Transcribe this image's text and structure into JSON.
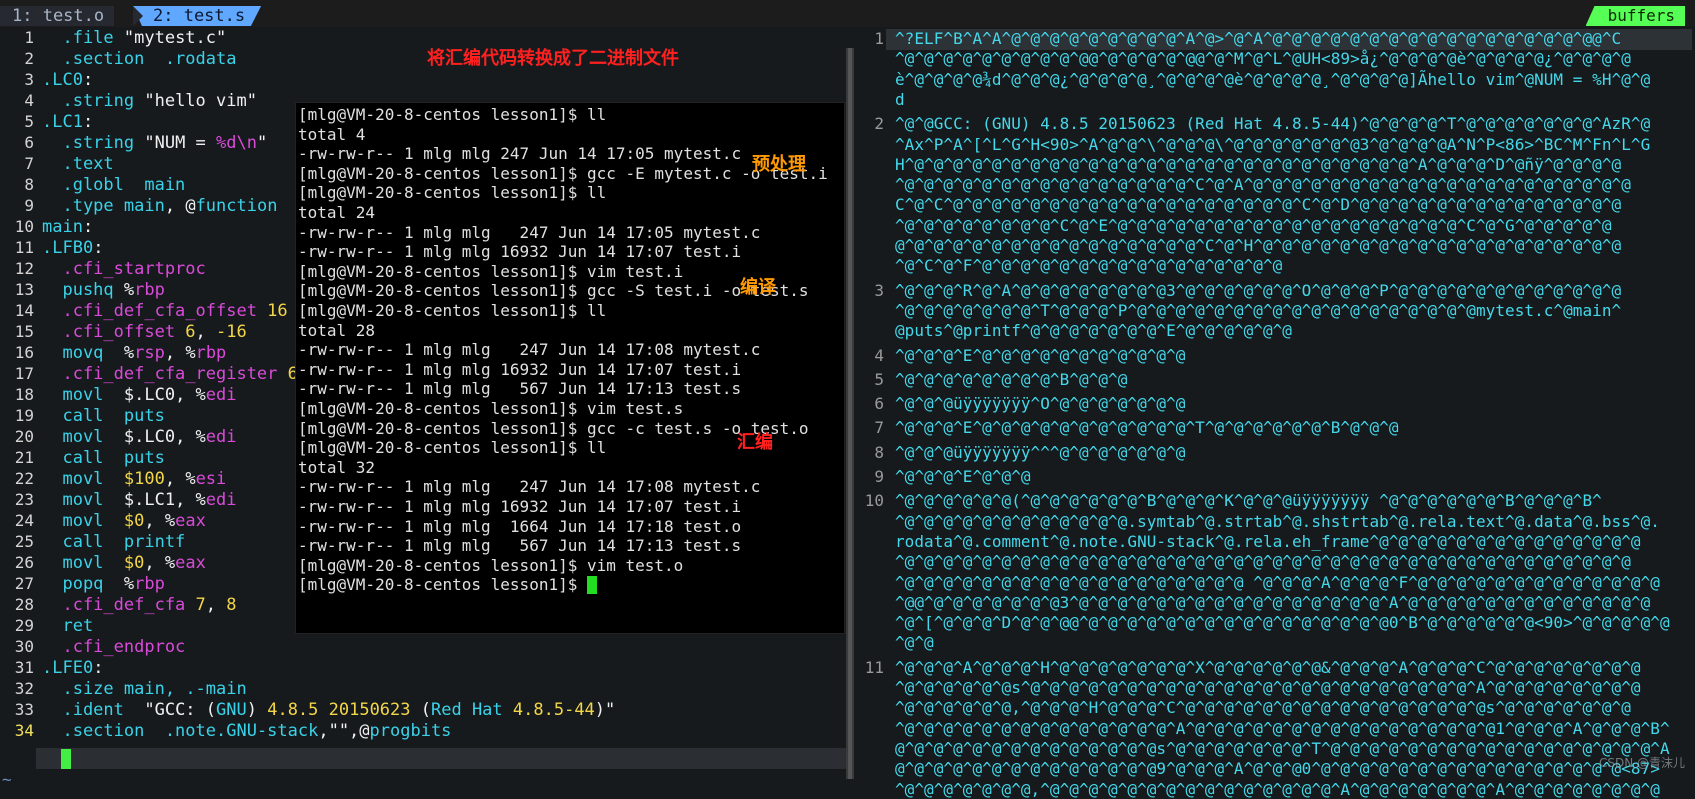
{
  "tabs": {
    "tab1": "1: test.o",
    "tab2": "2: test.s",
    "right": "buffers"
  },
  "left": {
    "numbers": [
      "1",
      "2",
      "3",
      "4",
      "5",
      "6",
      "7",
      "8",
      "9",
      "10",
      "11",
      "12",
      "13",
      "14",
      "15",
      "16",
      "17",
      "18",
      "19",
      "20",
      "21",
      "22",
      "23",
      "24",
      "25",
      "26",
      "27",
      "28",
      "29",
      "30",
      "31",
      "32",
      "33",
      "34"
    ],
    "lines": [
      [
        {
          "t": "  .file ",
          "c": "c-dir"
        },
        {
          "t": "\"mytest.c\"",
          "c": "c-str"
        }
      ],
      [
        {
          "t": "  .section  .rodata",
          "c": "c-dir"
        }
      ],
      [
        {
          "t": ".LC0",
          "c": "c-dir"
        },
        {
          "t": ":",
          "c": "c-lbl"
        }
      ],
      [
        {
          "t": "  .string ",
          "c": "c-dir"
        },
        {
          "t": "\"hello vim\"",
          "c": "c-str"
        }
      ],
      [
        {
          "t": ".LC1",
          "c": "c-dir"
        },
        {
          "t": ":",
          "c": "c-lbl"
        }
      ],
      [
        {
          "t": "  .string ",
          "c": "c-dir"
        },
        {
          "t": "\"NUM = ",
          "c": "c-str"
        },
        {
          "t": "%d",
          "c": "c-fmt"
        },
        {
          "t": "\\n",
          "c": "c-fmt"
        },
        {
          "t": "\"",
          "c": "c-str"
        }
      ],
      [
        {
          "t": "  .text",
          "c": "c-dir"
        }
      ],
      [
        {
          "t": "  .globl  main",
          "c": "c-dir"
        }
      ],
      [
        {
          "t": "  .type ",
          "c": "c-dir"
        },
        {
          "t": "main",
          "c": "c-func"
        },
        {
          "t": ", @",
          "c": "c-pct"
        },
        {
          "t": "function",
          "c": "c-func"
        }
      ],
      [
        {
          "t": "main",
          "c": "c-dir"
        },
        {
          "t": ":",
          "c": "c-lbl"
        }
      ],
      [
        {
          "t": ".LFB0",
          "c": "c-dir"
        },
        {
          "t": ":",
          "c": "c-lbl"
        }
      ],
      [
        {
          "t": "  .cfi_startproc",
          "c": "c-reg"
        }
      ],
      [
        {
          "t": "  pushq ",
          "c": "c-kw"
        },
        {
          "t": "%",
          "c": "c-pct"
        },
        {
          "t": "rbp",
          "c": "c-reg"
        }
      ],
      [
        {
          "t": "  .cfi_def_cfa_offset ",
          "c": "c-reg"
        },
        {
          "t": "16",
          "c": "c-num"
        }
      ],
      [
        {
          "t": "  .cfi_offset ",
          "c": "c-reg"
        },
        {
          "t": "6",
          "c": "c-num"
        },
        {
          "t": ", ",
          "c": "c-pct"
        },
        {
          "t": "-16",
          "c": "c-num"
        }
      ],
      [
        {
          "t": "  movq  ",
          "c": "c-kw"
        },
        {
          "t": "%",
          "c": "c-pct"
        },
        {
          "t": "rsp",
          "c": "c-reg"
        },
        {
          "t": ", %",
          "c": "c-pct"
        },
        {
          "t": "rbp",
          "c": "c-reg"
        }
      ],
      [
        {
          "t": "  .cfi_def_cfa_register ",
          "c": "c-reg"
        },
        {
          "t": "6",
          "c": "c-num"
        }
      ],
      [
        {
          "t": "  movl  ",
          "c": "c-kw"
        },
        {
          "t": "$.LC0, %",
          "c": "c-pct"
        },
        {
          "t": "edi",
          "c": "c-reg"
        }
      ],
      [
        {
          "t": "  call  puts",
          "c": "c-kw"
        }
      ],
      [
        {
          "t": "  movl  ",
          "c": "c-kw"
        },
        {
          "t": "$.LC0, %",
          "c": "c-pct"
        },
        {
          "t": "edi",
          "c": "c-reg"
        }
      ],
      [
        {
          "t": "  call  puts",
          "c": "c-kw"
        }
      ],
      [
        {
          "t": "  movl  ",
          "c": "c-kw"
        },
        {
          "t": "$100",
          "c": "c-num"
        },
        {
          "t": ", %",
          "c": "c-pct"
        },
        {
          "t": "esi",
          "c": "c-reg"
        }
      ],
      [
        {
          "t": "  movl  ",
          "c": "c-kw"
        },
        {
          "t": "$.LC1, %",
          "c": "c-pct"
        },
        {
          "t": "edi",
          "c": "c-reg"
        }
      ],
      [
        {
          "t": "  movl  ",
          "c": "c-kw"
        },
        {
          "t": "$0",
          "c": "c-num"
        },
        {
          "t": ", %",
          "c": "c-pct"
        },
        {
          "t": "eax",
          "c": "c-reg"
        }
      ],
      [
        {
          "t": "  call  printf",
          "c": "c-kw"
        }
      ],
      [
        {
          "t": "  movl  ",
          "c": "c-kw"
        },
        {
          "t": "$0",
          "c": "c-num"
        },
        {
          "t": ", %",
          "c": "c-pct"
        },
        {
          "t": "eax",
          "c": "c-reg"
        }
      ],
      [
        {
          "t": "  popq  ",
          "c": "c-kw"
        },
        {
          "t": "%",
          "c": "c-pct"
        },
        {
          "t": "rbp",
          "c": "c-reg"
        }
      ],
      [
        {
          "t": "  .cfi_def_cfa ",
          "c": "c-reg"
        },
        {
          "t": "7",
          "c": "c-num"
        },
        {
          "t": ", ",
          "c": "c-pct"
        },
        {
          "t": "8",
          "c": "c-num"
        }
      ],
      [
        {
          "t": "  ret",
          "c": "c-kw"
        }
      ],
      [
        {
          "t": "  .cfi_endproc",
          "c": "c-reg"
        }
      ],
      [
        {
          "t": ".LFE0",
          "c": "c-dir"
        },
        {
          "t": ":",
          "c": "c-lbl"
        }
      ],
      [
        {
          "t": "  .size ",
          "c": "c-dir"
        },
        {
          "t": "main",
          "c": "c-func"
        },
        {
          "t": ", .-main",
          "c": "c-dir"
        }
      ],
      [
        {
          "t": "  .ident  ",
          "c": "c-dir"
        },
        {
          "t": "\"GCC: (",
          "c": "c-str"
        },
        {
          "t": "GNU",
          "c": "c-dir"
        },
        {
          "t": ") ",
          "c": "c-str"
        },
        {
          "t": "4.8.5 20150623",
          "c": "c-num"
        },
        {
          "t": " (",
          "c": "c-str"
        },
        {
          "t": "Red Hat",
          "c": "c-dir"
        },
        {
          "t": " ",
          "c": "c-str"
        },
        {
          "t": "4.8.5-44",
          "c": "c-num"
        },
        {
          "t": ")\"",
          "c": "c-str"
        }
      ],
      [
        {
          "t": "  .section  .note.GNU-stack",
          "c": "c-dir"
        },
        {
          "t": ",\"\",@",
          "c": "c-str"
        },
        {
          "t": "progbits",
          "c": "c-dir"
        }
      ]
    ],
    "tilde": "~"
  },
  "terminal": {
    "lines": [
      "[mlg@VM-20-8-centos lesson1]$ ll",
      "total 4",
      "-rw-rw-r-- 1 mlg mlg 247 Jun 14 17:05 mytest.c",
      "[mlg@VM-20-8-centos lesson1]$ gcc -E mytest.c -o test.i",
      "[mlg@VM-20-8-centos lesson1]$ ll",
      "total 24",
      "-rw-rw-r-- 1 mlg mlg   247 Jun 14 17:05 mytest.c",
      "-rw-rw-r-- 1 mlg mlg 16932 Jun 14 17:07 test.i",
      "[mlg@VM-20-8-centos lesson1]$ vim test.i",
      "[mlg@VM-20-8-centos lesson1]$ gcc -S test.i -o test.s",
      "[mlg@VM-20-8-centos lesson1]$ ll",
      "total 28",
      "-rw-rw-r-- 1 mlg mlg   247 Jun 14 17:08 mytest.c",
      "-rw-rw-r-- 1 mlg mlg 16932 Jun 14 17:07 test.i",
      "-rw-rw-r-- 1 mlg mlg   567 Jun 14 17:13 test.s",
      "[mlg@VM-20-8-centos lesson1]$ vim test.s",
      "[mlg@VM-20-8-centos lesson1]$ gcc -c test.s -o test.o",
      "[mlg@VM-20-8-centos lesson1]$ ll",
      "total 32",
      "-rw-rw-r-- 1 mlg mlg   247 Jun 14 17:08 mytest.c",
      "-rw-rw-r-- 1 mlg mlg 16932 Jun 14 17:07 test.i",
      "-rw-rw-r-- 1 mlg mlg  1664 Jun 14 17:18 test.o",
      "-rw-rw-r-- 1 mlg mlg   567 Jun 14 17:13 test.s",
      "[mlg@VM-20-8-centos lesson1]$ vim test.o",
      "[mlg@VM-20-8-centos lesson1]$ "
    ]
  },
  "annotations": {
    "title": "将汇编代码转换成了二进制文件",
    "preprocess": "预处理",
    "compile": "编译",
    "assemble": "汇编"
  },
  "right": {
    "rows": [
      {
        "n": "1",
        "t": "^?ELF^B^A^A^@^@^@^@^@^@^@^@^@^A^@>^@^A^@^@^@^@^@^@^@^@^@^@^@^@^@^@^@^@^@@^C"
      },
      {
        "n": "",
        "t": "^@^@^@^@^@^@^@^@^@^@@^@^@^@^@^@@^@^M^@^L^@UH<89>å¿^@^@^@^@è^@^@^@^@¿^@^@^@^@"
      },
      {
        "n": "",
        "t": "è^@^@^@^@¾d^@^@^@¿^@^@^@^@¸^@^@^@^@è^@^@^@^@¸^@^@^@^@]Ãhello vim^@NUM = %H^@^@"
      },
      {
        "n": "",
        "t": "d"
      },
      {
        "n": "2",
        "t": "^@^@GCC: (GNU) 4.8.5 20150623 (Red Hat 4.8.5-44)^@^@^@^@^T^@^@^@^@^@^@^@^AzR^@"
      },
      {
        "n": "",
        "t": "^Ax^P^A^[^L^G^H<90>^A^@^@^\\^@^@^@\\^@^@^@^@^@^@^@3^@^@^@^@A^N^P<86>^BC^M^Fn^L^G"
      },
      {
        "n": "",
        "t": "H^@^@^@^@^@^@^@^@^@^@^@^@^@^@^@^@^@^@^@^@^@^@^@^@^@^@^A^@^@^@^D^@ñÿ^@^@^@^@"
      },
      {
        "n": "",
        "t": "^@^@^@^@^@^@^@^@^@^@^@^@^@^@^@^C^@^A^@^@^@^@^@^@^@^@^@^@^@^@^@^@^@^@^@^@^@^@"
      },
      {
        "n": "",
        "t": "C^@^C^@^@^@^@^@^@^@^@^@^@^@^@^@^@^@^@^@^@^C^@^D^@^@^@^@^@^@^@^@^@^@^@^@^@^@"
      },
      {
        "n": "",
        "t": "^@^@^@^@^@^@^@^@^C^@^E^@^@^@^@^@^@^@^@^@^@^@^@^@^@^@^@^@^@^C^@^G^@^@^@^@^@"
      },
      {
        "n": "",
        "t": "@^@^@^@^@^@^@^@^@^@^@^@^@^@^@^@^C^@^H^@^@^@^@^@^@^@^@^@^@^@^@^@^@^@^@^@^@^@"
      },
      {
        "n": "",
        "t": "^@^C^@^F^@^@^@^@^@^@^@^@^@^@^@^@^@^@^@^@"
      },
      {
        "n": "3",
        "t": "^@^@^@^R^@^A^@^@^@^@^@^@^@^@3^@^@^@^@^@^@^O^@^@^@^P^@^@^@^@^@^@^@^@^@^@^@^@"
      },
      {
        "n": "",
        "t": "^@^@^@^@^@^@^@^T^@^@^@^P^@^@^@^@^@^@^@^@^@^@^@^@^@^@^@^@^@^@mytest.c^@main^"
      },
      {
        "n": "",
        "t": "@puts^@printf^@^@^@^@^@^@^@^E^@^@^@^@^@^@"
      },
      {
        "n": "4",
        "t": "^@^@^@^E^@^@^@^@^@^@^@^@^@^@^@"
      },
      {
        "n": "5",
        "t": "^@^@^@^@^@^@^@^@^B^@^@^@"
      },
      {
        "n": "6",
        "t": "^@^@^@üÿÿÿÿÿÿÿ^O^@^@^@^@^@^@^@"
      },
      {
        "n": "7",
        "t": "^@^@^@^E^@^@^@^@^@^@^@^@^@^@^@^T^@^@^@^@^@^@^B^@^@^@"
      },
      {
        "n": "8",
        "t": "^@^@^@üÿÿÿÿÿÿÿ^^^@^@^@^@^@^@^@"
      },
      {
        "n": "9",
        "t": "^@^@^@^E^@^@^@"
      },
      {
        "n": "10",
        "t": "^@^@^@^@^@^@(^@^@^@^@^@^@^B^@^@^@^K^@^@^@üÿÿÿÿÿÿÿ ^@^@^@^@^@^@^B^@^@^@^B^"
      },
      {
        "n": "",
        "t": "^@^@^@^@^@^@^@^@^@^@^@^@.symtab^@.strtab^@.shstrtab^@.rela.text^@.data^@.bss^@."
      },
      {
        "n": "",
        "t": "rodata^@.comment^@.note.GNU-stack^@.rela.eh_frame^@^@^@^@^@^@^@^@^@^@^@^@^@^@"
      },
      {
        "n": "",
        "t": "^@^@^@^@^@^@^@^@^@^@^@^@^@^@^@^@^@^@^@^@^@^@^@^@^@^@^@^@^@^@^@^@^@^@^@^@^@^@"
      },
      {
        "n": "",
        "t": "^@^@^@^@^@^@^@^@^@^@^@^@^@^@^@^@^@^@ ^@^@^@^A^@^@^@^F^@^@^@^@^@^@^@^@^@^@^@^@^@"
      },
      {
        "n": "",
        "t": "^@@^@^@^@^@^@^@^@3^@^@^@^@^@^@^@^@^@^@^@^@^@^@^@^@^A^@^@^@^@^@^@^@^@^@^@^@^@^@"
      },
      {
        "n": "",
        "t": "^@^[^@^@^@^D^@^@^@@^@^@^@^@^@^@^@^@^@^@^@^@^@^@^@^@0^B^@^@^@^@^@^@<90>^@^@^@^@^@"
      },
      {
        "n": "",
        "t": "^@^@"
      },
      {
        "n": "11",
        "t": "^@^@^@^A^@^@^@^H^@^@^@^@^@^@^@^X^@^@^@^@^@^@&^@^@^@^A^@^@^@^C^@^@^@^@^@^@^@^@"
      },
      {
        "n": "",
        "t": "^@^@^@^@^@^@s^@^@^@^@^@^@^@^@^@^@^@^@^@^@^@^@^@^@^@^@^@^@^@^A^@^@^@^@^@^@^@^@"
      },
      {
        "n": "",
        "t": "^@^@^@^@^@^@,^@^@^@^H^@^@^@^C^@^@^@^@^@^@^@^@^@^@^@^@^@^@^@^@s^@^@^@^@^@^@^@"
      },
      {
        "n": "",
        "t": "^@^@^@^@^@^@^@^@^@^@^@^@^@^@^A^@^@^@^@^@^@^@^@^@^@^@^@^@^@^@^@1^@^@^@^A^@^@^@^B^"
      },
      {
        "n": "",
        "t": "@^@^@^@^@^@^@^@^@^@^@^@^@^@s^@^@^@^@^@^@^@^T^@^@^@^@^@^@^@^@^@^@^@^@^@^@^@^@^@^A"
      },
      {
        "n": "",
        "t": "@^@^@^@^@^@^@^@^@^@^@^@^@^@9^@^@^@^A^@^@^@0^@^@^@^@^@^@^@^@^@^@^@^@^@^@^@^@<87>"
      },
      {
        "n": "",
        "t": "^@^@^@^@^@^@^@,^@^@^@^@^@^@^@^@^@^@^@^@^@^@^@^A^@^@^@^@^@^@^@^A^@^@^@^@^@^@^@^@"
      }
    ]
  },
  "watermark": "CSDN @青沫儿"
}
